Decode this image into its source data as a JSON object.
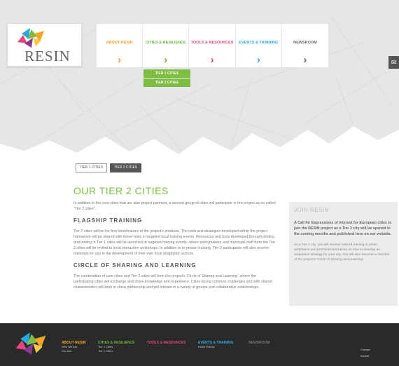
{
  "logo": {
    "text": "RESIN"
  },
  "nav": {
    "items": [
      {
        "label": "ABOUT RESIN",
        "arrow": "›",
        "color": "#f5a623"
      },
      {
        "label": "CITIES & RESILIENCE",
        "arrow": "›",
        "color": "#6db33f"
      },
      {
        "label": "TOOLS & RESOURCES",
        "arrow": "›",
        "color": "#e8467c"
      },
      {
        "label": "EVENTS & TRAINING",
        "arrow": "›",
        "color": "#29abe2"
      },
      {
        "label": "NEWSROOM",
        "arrow": "›",
        "color": "#666666"
      }
    ],
    "submenu": [
      "TIER 1 CITIES",
      "TIER 2 CITIES"
    ]
  },
  "tabs": {
    "tier1": "TIER 1 CITIES",
    "tier2": "TIER 2 CITIES"
  },
  "main": {
    "title": "OUR TIER 2 CITIES",
    "intro": "In addition to the core cities that are also project partners, a second group of cities will participate in the project as so-called \"Tier 2 cities\".",
    "section1_heading": "FLAGSHIP TRAINING",
    "section1_text": "Tier 2 cities will be the first beneficiaries of the project's products. The tools and strategies developed within the project framework will be shared with these cities in targeted local training events. Resources and tools developed through piloting and testing in Tier 1 cities will be launched at targeted training events, where policymakers and municipal staff from the Tier 2 cities will be invited to local interactive workshops. In addition to in-person training, Tier 2 participants will also receive materials for use in the development of their own local adaptation actions.",
    "section2_heading": "CIRCLE OF SHARING AND LEARNING",
    "section2_text": "The combination of core cities and Tier 2 cities will form the project's 'Circle of Sharing and Learning', where the participating cities will exchange and share knowledge and experience. Cities facing common challenges and with shared characteristics will work in close partnership and will interact in a variety of groups and collaborative relationships."
  },
  "sidebar": {
    "title": "JOIN RESIN",
    "bold_text": "A Call for Expressions of Interest for European cities to join the RESIN project as a Tier 2 city will be opened in the coming months and published here on our website.",
    "text": "As a Tier 2 city, you will receive tailored training in urban adaptation and practical information on how to develop an adaptation strategy for your city. You will also become a member of the project's 'Circle of Sharing and Learning'."
  },
  "footer": {
    "cols": [
      {
        "heading": "ABOUT RESIN",
        "color": "#f5a623",
        "links": [
          "Who We Are",
          "Our Aim"
        ]
      },
      {
        "heading": "CITIES & RESILIENCE",
        "color": "#6db33f",
        "links": [
          "Tier 1 Cities",
          "Tier 2 Cities"
        ]
      },
      {
        "heading": "TOOLS & RESOURCES",
        "color": "#e8467c",
        "links": []
      },
      {
        "heading": "EVENTS & TRAINING",
        "color": "#29abe2",
        "links": [
          "Resin Events"
        ]
      },
      {
        "heading": "NEWSROOM",
        "color": "#777777",
        "links": []
      }
    ],
    "right_links": [
      "Contact",
      "Imprint"
    ]
  }
}
